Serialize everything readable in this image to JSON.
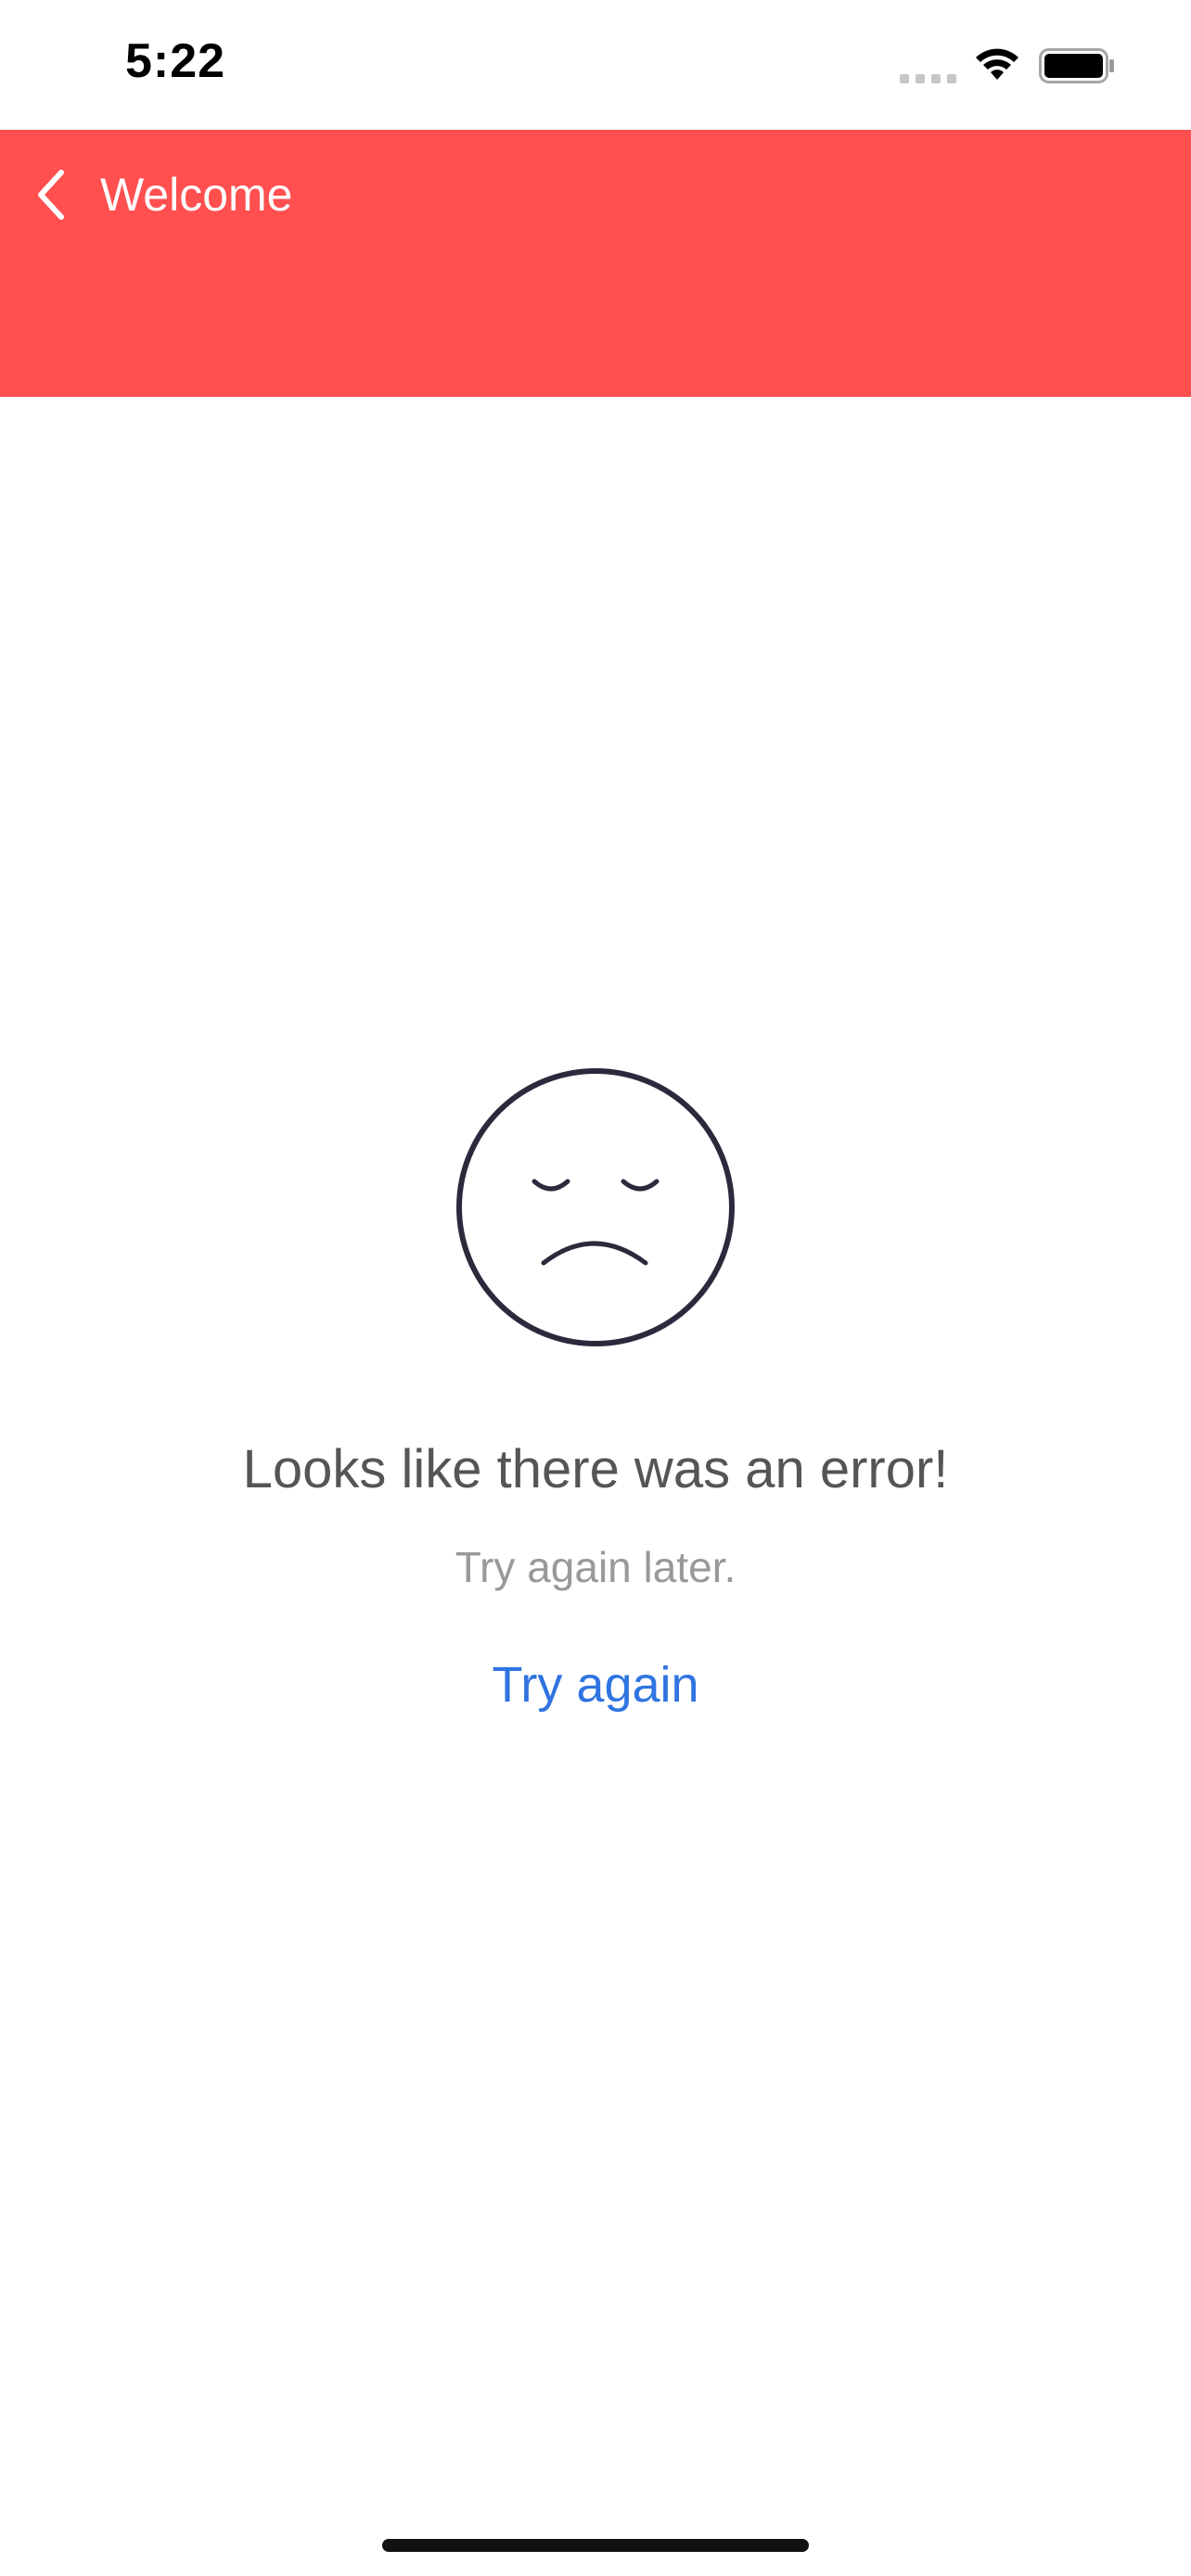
{
  "status_bar": {
    "time": "5:22"
  },
  "header": {
    "back_label": "Welcome",
    "background_color": "#ff4f4f"
  },
  "error": {
    "icon": "sad-face-icon",
    "title": "Looks like there was an error!",
    "subtitle": "Try again later.",
    "retry_label": "Try again",
    "link_color": "#2f74e0"
  }
}
